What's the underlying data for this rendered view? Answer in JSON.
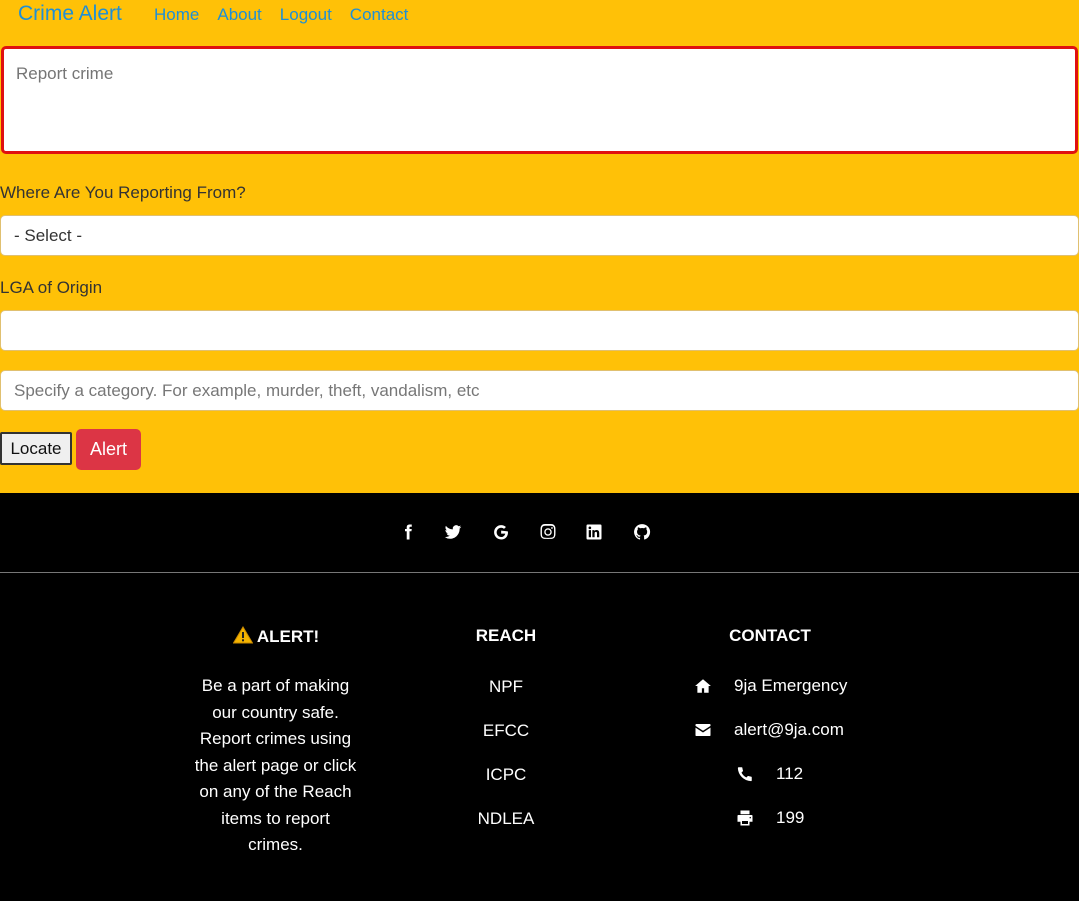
{
  "nav": {
    "brand": "Crime Alert",
    "links": [
      "Home",
      "About",
      "Logout",
      "Contact"
    ]
  },
  "form": {
    "report_placeholder": "Report crime",
    "where_label": "Where Are You Reporting From?",
    "where_selected": "- Select -",
    "lga_label": "LGA of Origin",
    "lga_value": "",
    "category_placeholder": "Specify a category. For example, murder, theft, vandalism, etc",
    "locate_label": "Locate",
    "alert_label": "Alert"
  },
  "colors": {
    "page_bg": "#ffc107",
    "brand": "#1e8fd6",
    "alert_button": "#dc3545",
    "report_border": "#e01010",
    "footer_bg": "#000000"
  },
  "footer": {
    "social_icons": [
      "facebook-icon",
      "twitter-icon",
      "google-icon",
      "instagram-icon",
      "linkedin-icon",
      "github-icon"
    ],
    "alert": {
      "title": "ALERT!",
      "icon": "warning-icon",
      "text": "Be a part of making our country safe. Report crimes using the alert page or click on any of the Reach items to report crimes."
    },
    "reach": {
      "title": "REACH",
      "items": [
        "NPF",
        "EFCC",
        "ICPC",
        "NDLEA"
      ]
    },
    "contact": {
      "title": "CONTACT",
      "items": [
        {
          "icon": "home-icon",
          "text": "9ja Emergency"
        },
        {
          "icon": "envelope-icon",
          "text": "alert@9ja.com"
        },
        {
          "icon": "phone-icon",
          "text": "112"
        },
        {
          "icon": "print-icon",
          "text": "199"
        }
      ]
    }
  }
}
